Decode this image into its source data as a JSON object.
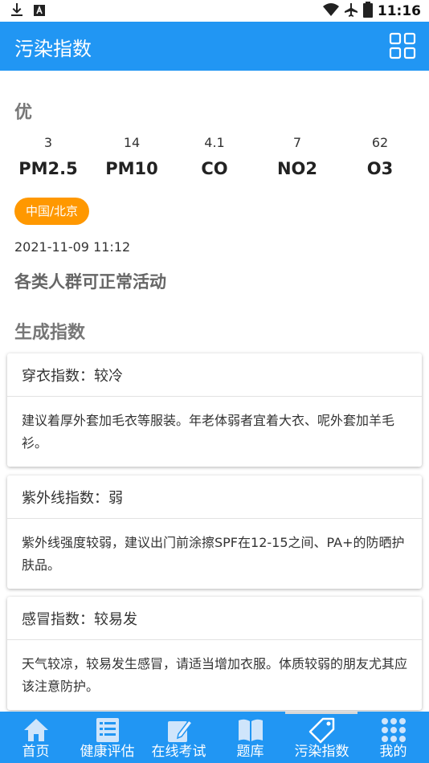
{
  "status_bar": {
    "time": "11:16"
  },
  "app_bar": {
    "title": "污染指数"
  },
  "air": {
    "quality": "优",
    "metrics": [
      {
        "value": "3",
        "name": "PM2.5"
      },
      {
        "value": "14",
        "name": "PM10"
      },
      {
        "value": "4.1",
        "name": "CO"
      },
      {
        "value": "7",
        "name": "NO2"
      },
      {
        "value": "62",
        "name": "O3"
      }
    ],
    "city": "中国/北京",
    "datetime": "2021-11-09 11:12",
    "advice": "各类人群可正常活动"
  },
  "indices": {
    "section_title": "生成指数",
    "cards": [
      {
        "title": "穿衣指数：较冷",
        "body": "建议着厚外套加毛衣等服装。年老体弱者宜着大衣、呢外套加羊毛衫。"
      },
      {
        "title": "紫外线指数：弱",
        "body": "紫外线强度较弱，建议出门前涂擦SPF在12-15之间、PA+的防晒护肤品。"
      },
      {
        "title": "感冒指数：较易发",
        "body": "天气较凉，较易发生感冒，请适当增加衣服。体质较弱的朋友尤其应该注意防护。"
      }
    ]
  },
  "bottom_nav": {
    "items": [
      {
        "label": "首页",
        "icon": "home-icon"
      },
      {
        "label": "健康评估",
        "icon": "list-icon"
      },
      {
        "label": "在线考试",
        "icon": "edit-icon"
      },
      {
        "label": "题库",
        "icon": "book-icon"
      },
      {
        "label": "污染指数",
        "icon": "tag-icon"
      },
      {
        "label": "我的",
        "icon": "apps-grid-icon"
      }
    ],
    "active_index": 4
  },
  "colors": {
    "primary": "#2196f3",
    "accent": "#ff9800"
  }
}
